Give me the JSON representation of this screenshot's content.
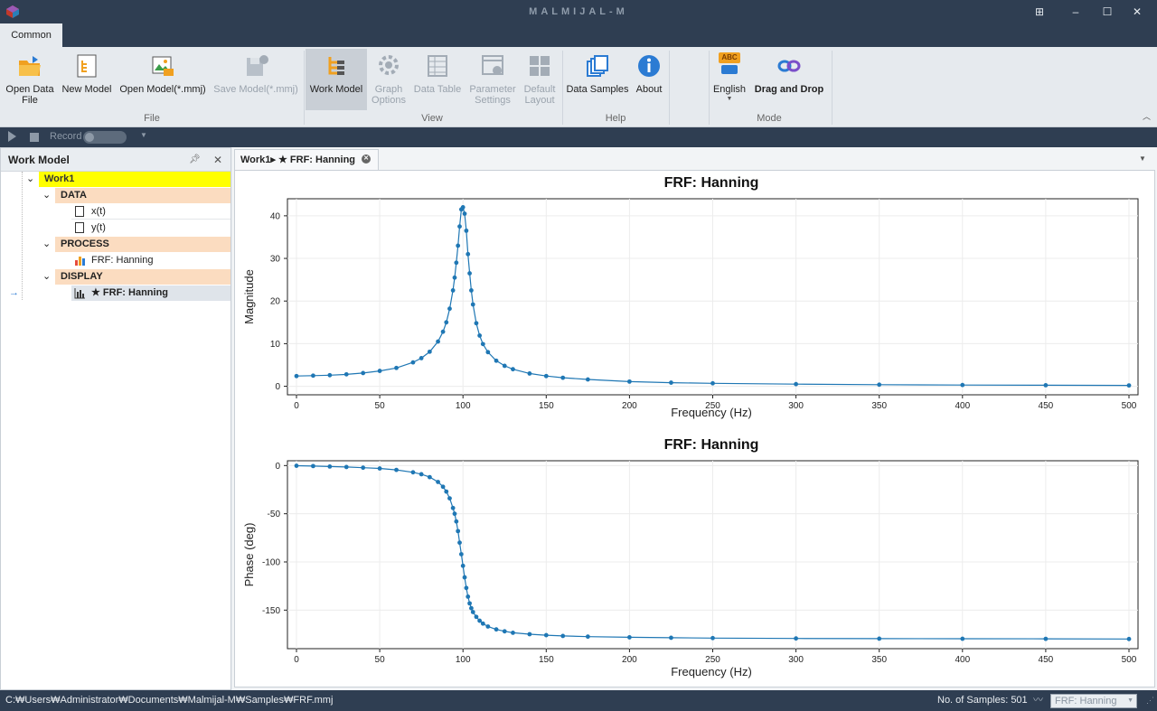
{
  "app": {
    "title": "MALMIJAL-M"
  },
  "ribbon": {
    "tab": "Common",
    "buttons": {
      "open_data_file": "Open Data\nFile",
      "new_model": "New Model",
      "open_model": "Open Model(*.mmj)",
      "save_model": "Save Model(*.mmj)",
      "work_model": "Work Model",
      "graph_options": "Graph\nOptions",
      "data_table": "Data Table",
      "parameter_settings": "Parameter\nSettings",
      "default_layout": "Default\nLayout",
      "data_samples": "Data Samples",
      "about": "About",
      "english": "English",
      "abc_badge": "ABC",
      "drag_and_drop": "Drag and Drop"
    },
    "groups": {
      "file": "File",
      "view": "View",
      "help": "Help",
      "mode": "Mode"
    }
  },
  "toolbar": {
    "record": "Record"
  },
  "work_model": {
    "title": "Work Model",
    "tree": {
      "root": "Work1",
      "data": "DATA",
      "x": "x(t)",
      "y": "y(t)",
      "process": "PROCESS",
      "frf": "FRF: Hanning",
      "display": "DISPLAY",
      "display_item": "★ FRF: Hanning"
    }
  },
  "document": {
    "tab": "Work1▸ ★ FRF: Hanning"
  },
  "chart_data": [
    {
      "type": "line",
      "title": "FRF: Hanning",
      "xlabel": "Frequency (Hz)",
      "ylabel": "Magnitude",
      "xlim": [
        0,
        500
      ],
      "ylim": [
        -2,
        44
      ],
      "xticks": [
        0,
        50,
        100,
        150,
        200,
        250,
        300,
        350,
        400,
        450,
        500
      ],
      "yticks": [
        0,
        10,
        20,
        30,
        40
      ],
      "grid": true,
      "color": "#1f77b4",
      "x": [
        0,
        10,
        20,
        30,
        40,
        50,
        60,
        70,
        75,
        80,
        85,
        88,
        90,
        92,
        94,
        95,
        96,
        97,
        98,
        99,
        100,
        101,
        102,
        103,
        104,
        105,
        106,
        108,
        110,
        112,
        115,
        120,
        125,
        130,
        140,
        150,
        160,
        175,
        200,
        225,
        250,
        300,
        350,
        400,
        450,
        500
      ],
      "y": [
        2.4,
        2.5,
        2.6,
        2.8,
        3.1,
        3.6,
        4.3,
        5.6,
        6.6,
        8.1,
        10.5,
        12.8,
        15.0,
        18.2,
        22.5,
        25.5,
        29.0,
        33.0,
        37.5,
        41.5,
        42.0,
        40.5,
        36.5,
        31.0,
        26.5,
        22.5,
        19.2,
        14.8,
        11.9,
        9.9,
        8.0,
        6.0,
        4.8,
        4.0,
        3.0,
        2.4,
        2.0,
        1.6,
        1.1,
        0.85,
        0.7,
        0.5,
        0.38,
        0.3,
        0.25,
        0.2
      ]
    },
    {
      "type": "line",
      "title": "FRF: Hanning",
      "xlabel": "Frequency (Hz)",
      "ylabel": "Phase (deg)",
      "xlim": [
        0,
        500
      ],
      "ylim": [
        -190,
        5
      ],
      "xticks": [
        0,
        50,
        100,
        150,
        200,
        250,
        300,
        350,
        400,
        450,
        500
      ],
      "yticks": [
        0,
        -50,
        -100,
        -150
      ],
      "grid": true,
      "color": "#1f77b4",
      "x": [
        0,
        10,
        20,
        30,
        40,
        50,
        60,
        70,
        75,
        80,
        85,
        88,
        90,
        92,
        94,
        95,
        96,
        97,
        98,
        99,
        100,
        101,
        102,
        103,
        104,
        105,
        106,
        108,
        110,
        112,
        115,
        120,
        125,
        130,
        140,
        150,
        160,
        175,
        200,
        225,
        250,
        300,
        350,
        400,
        450,
        500
      ],
      "y": [
        -0.2,
        -0.5,
        -1.0,
        -1.5,
        -2.2,
        -3.0,
        -4.5,
        -7.0,
        -9.0,
        -12.0,
        -17.0,
        -22.0,
        -27.0,
        -34.0,
        -44.0,
        -50.0,
        -58.0,
        -68.0,
        -80.0,
        -92.0,
        -104.0,
        -116.0,
        -127.0,
        -136.0,
        -143.0,
        -148.0,
        -152.0,
        -157.0,
        -161.0,
        -164.0,
        -167.0,
        -170.0,
        -172.0,
        -173.5,
        -175.0,
        -176.0,
        -176.8,
        -177.5,
        -178.2,
        -178.7,
        -179.0,
        -179.4,
        -179.6,
        -179.7,
        -179.8,
        -180.0
      ]
    }
  ],
  "status": {
    "path": "C:₩Users₩Administrator₩Documents₩Malmijal-M₩Samples₩FRF.mmj",
    "samples": "No. of Samples: 501",
    "selector": "FRF: Hanning"
  }
}
